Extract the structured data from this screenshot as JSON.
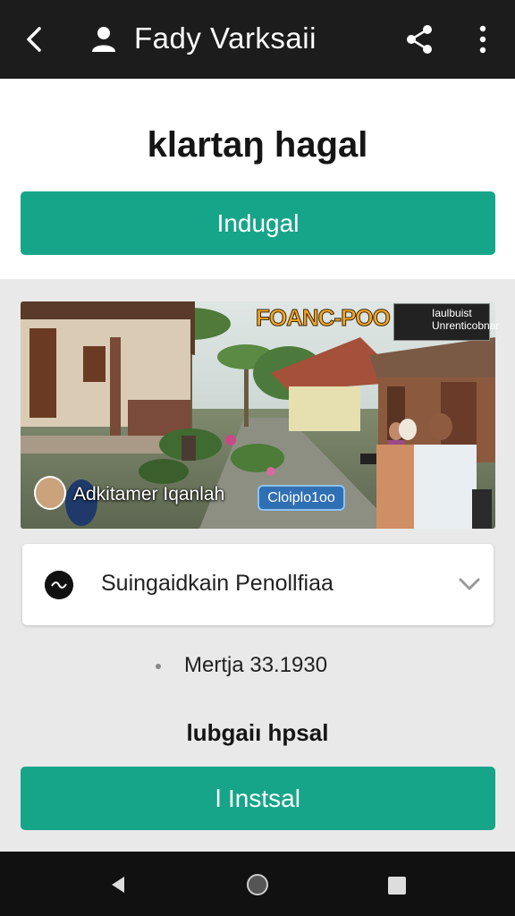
{
  "header": {
    "title": "Fady Varksaii",
    "back_icon": "chevron-left-icon",
    "profile_icon": "person-icon",
    "share_icon": "share-icon",
    "more_icon": "more-vertical-icon"
  },
  "main": {
    "heading": "klartaŋ hagal",
    "primary_button_label": "Indugal"
  },
  "photo": {
    "caption": "Adkitamer Iqanlah",
    "chip_label": "Cloiplo1oo",
    "badge_text": "FOANC-POO",
    "logo_text": "Iaulbuist Unrenticobnar"
  },
  "dropdown": {
    "icon": "wave-circle-icon",
    "selected_value": "Suingaidkain Penollfiaa",
    "chevron_icon": "chevron-down-icon"
  },
  "meta": {
    "text": "Mertja 33.1930"
  },
  "footer": {
    "sub_heading": "lubgaiı hpsal",
    "install_button_label": "l Instsal"
  },
  "navigation": {
    "back_icon": "nav-back-icon",
    "home_icon": "nav-home-icon",
    "recent_icon": "nav-recent-icon"
  },
  "colors": {
    "accent": "#17a58a",
    "topbar": "#1c1c1c",
    "background": "#e9e9e9",
    "chip": "#2f6fb3"
  }
}
